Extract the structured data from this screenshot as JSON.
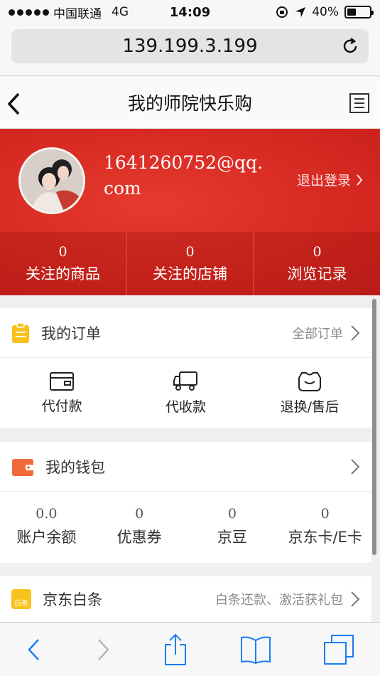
{
  "status_bar": {
    "carrier": "中国联通",
    "network": "4G",
    "time": "14:09",
    "battery_percent": "40%",
    "battery_level": 0.4
  },
  "url_bar": {
    "address": "139.199.3.199",
    "reload_icon": "reload-icon"
  },
  "header": {
    "title": "我的师院快乐购",
    "back_icon": "chevron-left-icon",
    "menu_icon": "list-icon"
  },
  "user": {
    "username": "1641260752@qq.com",
    "logout_label": "退出登录",
    "stats": [
      {
        "value": "0",
        "label": "关注的商品"
      },
      {
        "value": "0",
        "label": "关注的店铺"
      },
      {
        "value": "0",
        "label": "浏览记录"
      }
    ]
  },
  "orders": {
    "title": "我的订单",
    "more_label": "全部订单",
    "items": [
      {
        "label": "代付款",
        "icon": "wallet-icon"
      },
      {
        "label": "代收款",
        "icon": "truck-icon"
      },
      {
        "label": "退换/售后",
        "icon": "refund-icon"
      }
    ]
  },
  "wallet": {
    "title": "我的钱包",
    "items": [
      {
        "value": "0.0",
        "label": "账户余额"
      },
      {
        "value": "0",
        "label": "优惠券"
      },
      {
        "value": "0",
        "label": "京豆"
      },
      {
        "value": "0",
        "label": "京东卡/E卡"
      }
    ]
  },
  "baitiao": {
    "title": "京东白条",
    "icon_text": "白条",
    "more_label": "白条还款、激活获礼包"
  },
  "colors": {
    "brand_red": "#d72a22",
    "order_icon": "#f7c21b",
    "wallet_icon": "#f26a3c",
    "ios_blue": "#1a7cf5"
  }
}
